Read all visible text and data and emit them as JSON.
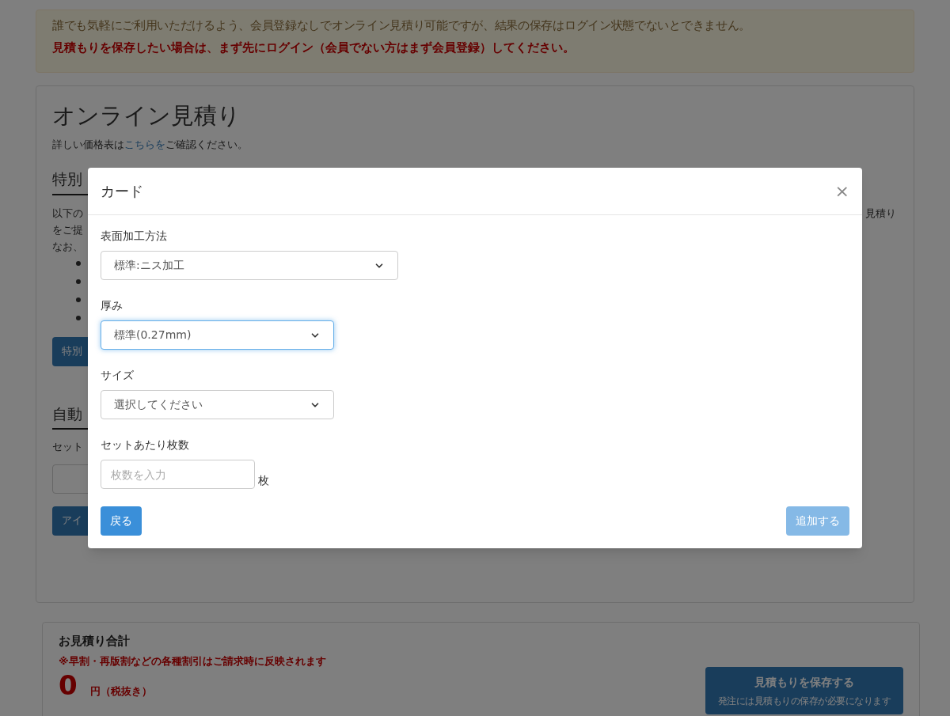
{
  "notice": {
    "text": "誰でも気軽にご利用いただけるよう、会員登録なしでオンライン見積り可能ですが、結果の保存はログイン状態でないとできません。",
    "warning": "見積もりを保存したい場合は、まず先にログイン（会員でない方はまず会員登録）してください。"
  },
  "panel": {
    "title": "オンライン見積り",
    "intro_before": "詳しい価格表は",
    "intro_link": "こちらを",
    "intro_after": "ご確認ください。"
  },
  "special": {
    "heading": "特別",
    "lines": [
      "以下の",
      "をご提",
      "なお、"
    ],
    "line_tail": "見積り",
    "bullets": [
      {
        "kind": "bullet"
      },
      {
        "kind": "bullet"
      },
      {
        "kind": "bullet"
      },
      {
        "kind": "bullet"
      }
    ],
    "button": "特別"
  },
  "auto": {
    "heading": "自動",
    "label": "セット",
    "button": "アイ"
  },
  "modal": {
    "title": "カード",
    "close": "×",
    "fields": [
      {
        "kind": "select",
        "label": "表面加工方法",
        "value": "標準:ニス加工",
        "focused": false,
        "wide": true
      },
      {
        "kind": "select",
        "label": "厚み",
        "value": "標準(0.27mm)",
        "focused": true,
        "wide": false
      },
      {
        "kind": "select",
        "label": "サイズ",
        "value": "選択してください",
        "focused": false,
        "wide": false
      },
      {
        "kind": "number",
        "label": "セットあたり枚数",
        "placeholder": "枚数を入力",
        "unit": "枚"
      }
    ],
    "back_button": {
      "label": "戻る",
      "disabled": false
    },
    "add_button": {
      "label": "追加する",
      "disabled": true
    }
  },
  "total": {
    "title": "お見積り合計",
    "note": "※早割・再版割などの各種割引はご請求時に反映されます",
    "amount": "0",
    "unit": "円（税抜き）",
    "save_button": {
      "label": "見積もりを保存する",
      "sub": "発注には見積もりの保存が必要になります"
    }
  }
}
